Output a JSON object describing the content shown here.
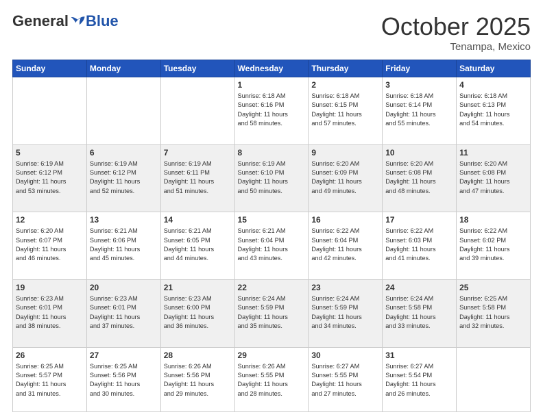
{
  "logo": {
    "general": "General",
    "blue": "Blue"
  },
  "header": {
    "month": "October 2025",
    "location": "Tenampa, Mexico"
  },
  "days": [
    "Sunday",
    "Monday",
    "Tuesday",
    "Wednesday",
    "Thursday",
    "Friday",
    "Saturday"
  ],
  "weeks": [
    [
      {
        "day": "",
        "info": ""
      },
      {
        "day": "",
        "info": ""
      },
      {
        "day": "",
        "info": ""
      },
      {
        "day": "1",
        "info": "Sunrise: 6:18 AM\nSunset: 6:16 PM\nDaylight: 11 hours\nand 58 minutes."
      },
      {
        "day": "2",
        "info": "Sunrise: 6:18 AM\nSunset: 6:15 PM\nDaylight: 11 hours\nand 57 minutes."
      },
      {
        "day": "3",
        "info": "Sunrise: 6:18 AM\nSunset: 6:14 PM\nDaylight: 11 hours\nand 55 minutes."
      },
      {
        "day": "4",
        "info": "Sunrise: 6:18 AM\nSunset: 6:13 PM\nDaylight: 11 hours\nand 54 minutes."
      }
    ],
    [
      {
        "day": "5",
        "info": "Sunrise: 6:19 AM\nSunset: 6:12 PM\nDaylight: 11 hours\nand 53 minutes."
      },
      {
        "day": "6",
        "info": "Sunrise: 6:19 AM\nSunset: 6:12 PM\nDaylight: 11 hours\nand 52 minutes."
      },
      {
        "day": "7",
        "info": "Sunrise: 6:19 AM\nSunset: 6:11 PM\nDaylight: 11 hours\nand 51 minutes."
      },
      {
        "day": "8",
        "info": "Sunrise: 6:19 AM\nSunset: 6:10 PM\nDaylight: 11 hours\nand 50 minutes."
      },
      {
        "day": "9",
        "info": "Sunrise: 6:20 AM\nSunset: 6:09 PM\nDaylight: 11 hours\nand 49 minutes."
      },
      {
        "day": "10",
        "info": "Sunrise: 6:20 AM\nSunset: 6:08 PM\nDaylight: 11 hours\nand 48 minutes."
      },
      {
        "day": "11",
        "info": "Sunrise: 6:20 AM\nSunset: 6:08 PM\nDaylight: 11 hours\nand 47 minutes."
      }
    ],
    [
      {
        "day": "12",
        "info": "Sunrise: 6:20 AM\nSunset: 6:07 PM\nDaylight: 11 hours\nand 46 minutes."
      },
      {
        "day": "13",
        "info": "Sunrise: 6:21 AM\nSunset: 6:06 PM\nDaylight: 11 hours\nand 45 minutes."
      },
      {
        "day": "14",
        "info": "Sunrise: 6:21 AM\nSunset: 6:05 PM\nDaylight: 11 hours\nand 44 minutes."
      },
      {
        "day": "15",
        "info": "Sunrise: 6:21 AM\nSunset: 6:04 PM\nDaylight: 11 hours\nand 43 minutes."
      },
      {
        "day": "16",
        "info": "Sunrise: 6:22 AM\nSunset: 6:04 PM\nDaylight: 11 hours\nand 42 minutes."
      },
      {
        "day": "17",
        "info": "Sunrise: 6:22 AM\nSunset: 6:03 PM\nDaylight: 11 hours\nand 41 minutes."
      },
      {
        "day": "18",
        "info": "Sunrise: 6:22 AM\nSunset: 6:02 PM\nDaylight: 11 hours\nand 39 minutes."
      }
    ],
    [
      {
        "day": "19",
        "info": "Sunrise: 6:23 AM\nSunset: 6:01 PM\nDaylight: 11 hours\nand 38 minutes."
      },
      {
        "day": "20",
        "info": "Sunrise: 6:23 AM\nSunset: 6:01 PM\nDaylight: 11 hours\nand 37 minutes."
      },
      {
        "day": "21",
        "info": "Sunrise: 6:23 AM\nSunset: 6:00 PM\nDaylight: 11 hours\nand 36 minutes."
      },
      {
        "day": "22",
        "info": "Sunrise: 6:24 AM\nSunset: 5:59 PM\nDaylight: 11 hours\nand 35 minutes."
      },
      {
        "day": "23",
        "info": "Sunrise: 6:24 AM\nSunset: 5:59 PM\nDaylight: 11 hours\nand 34 minutes."
      },
      {
        "day": "24",
        "info": "Sunrise: 6:24 AM\nSunset: 5:58 PM\nDaylight: 11 hours\nand 33 minutes."
      },
      {
        "day": "25",
        "info": "Sunrise: 6:25 AM\nSunset: 5:58 PM\nDaylight: 11 hours\nand 32 minutes."
      }
    ],
    [
      {
        "day": "26",
        "info": "Sunrise: 6:25 AM\nSunset: 5:57 PM\nDaylight: 11 hours\nand 31 minutes."
      },
      {
        "day": "27",
        "info": "Sunrise: 6:25 AM\nSunset: 5:56 PM\nDaylight: 11 hours\nand 30 minutes."
      },
      {
        "day": "28",
        "info": "Sunrise: 6:26 AM\nSunset: 5:56 PM\nDaylight: 11 hours\nand 29 minutes."
      },
      {
        "day": "29",
        "info": "Sunrise: 6:26 AM\nSunset: 5:55 PM\nDaylight: 11 hours\nand 28 minutes."
      },
      {
        "day": "30",
        "info": "Sunrise: 6:27 AM\nSunset: 5:55 PM\nDaylight: 11 hours\nand 27 minutes."
      },
      {
        "day": "31",
        "info": "Sunrise: 6:27 AM\nSunset: 5:54 PM\nDaylight: 11 hours\nand 26 minutes."
      },
      {
        "day": "",
        "info": ""
      }
    ]
  ]
}
